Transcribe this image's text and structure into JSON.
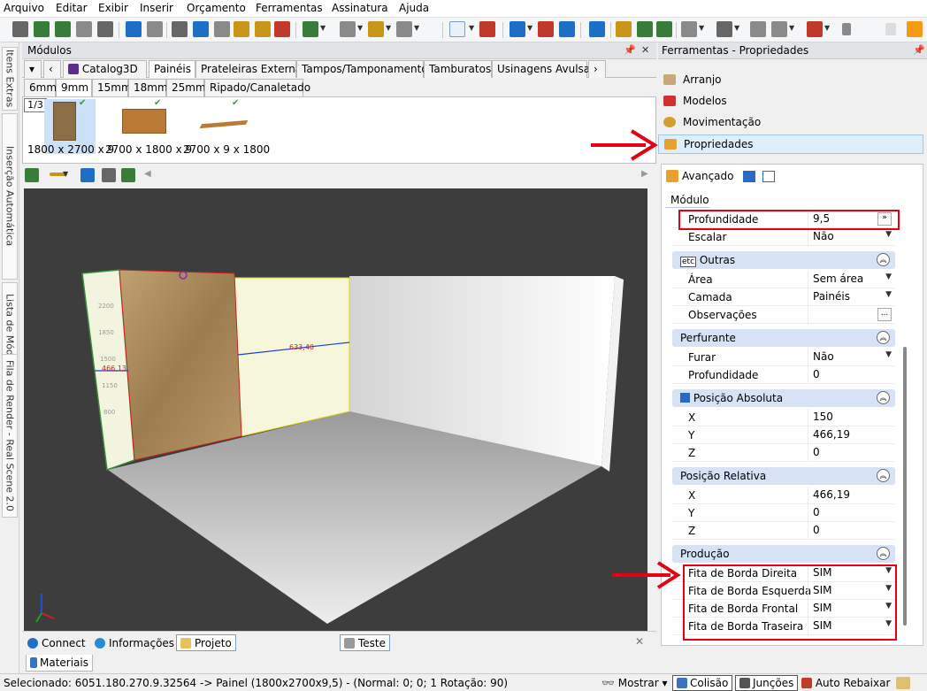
{
  "menu": [
    "Arquivo",
    "Editar",
    "Exibir",
    "Inserir",
    "Orçamento",
    "Ferramentas",
    "Assinatura",
    "Ajuda"
  ],
  "left_tabs": [
    "Itens Extras",
    "Inserção Automática",
    "Lista de Módulos",
    "Fila de Render - Real Scene 2.0"
  ],
  "modulos": {
    "title": "Módulos",
    "tabs": [
      "Catalog3D",
      "Painéis",
      "Prateleiras Externas",
      "Tampos/Tamponamentos",
      "Tamburatos",
      "Usinagens Avulsas"
    ],
    "thickness_tabs": [
      "6mm",
      "9mm",
      "15mm",
      "18mm",
      "25mm",
      "Ripado/Canaletado"
    ],
    "page": "1/3",
    "thumbs": [
      "1800 x 2700 x 9",
      "2700 x 1800 x 9",
      "2700 x 9 x 1800"
    ],
    "dims": [
      "466,13",
      "633,40",
      "2200",
      "1850",
      "1500",
      "1150",
      "800"
    ]
  },
  "bottom_tabs": [
    "Connect",
    "Informações",
    "Projeto",
    "Teste"
  ],
  "materiais": "Materiais",
  "ferramentas": {
    "title": "Ferramentas - Propriedades",
    "items": [
      "Arranjo",
      "Modelos",
      "Movimentação",
      "Propriedades"
    ]
  },
  "props": {
    "avancado": "Avançado",
    "modulo": "Módulo",
    "profundidade": {
      "label": "Profundidade",
      "value": "9,5",
      "btn": "»"
    },
    "escalar": {
      "label": "Escalar",
      "value": "Não"
    },
    "outras": "Outras",
    "outras_icon": "etc",
    "area": {
      "label": "Área",
      "value": "Sem área"
    },
    "camada": {
      "label": "Camada",
      "value": "Painéis"
    },
    "obs": {
      "label": "Observações",
      "value": "",
      "btn": "..."
    },
    "perfurante": "Perfurante",
    "furar": {
      "label": "Furar",
      "value": "Não"
    },
    "prof2": {
      "label": "Profundidade",
      "value": "0"
    },
    "pos_abs": "Posição Absoluta",
    "abs_x": {
      "label": "X",
      "value": "150"
    },
    "abs_y": {
      "label": "Y",
      "value": "466,19"
    },
    "abs_z": {
      "label": "Z",
      "value": "0"
    },
    "pos_rel": "Posição Relativa",
    "rel_x": {
      "label": "X",
      "value": "466,19"
    },
    "rel_y": {
      "label": "Y",
      "value": "0"
    },
    "rel_z": {
      "label": "Z",
      "value": "0"
    },
    "producao": "Produção",
    "fita_dir": {
      "label": "Fita de Borda Direita",
      "value": "SIM"
    },
    "fita_esq": {
      "label": "Fita de Borda Esquerda",
      "value": "SIM"
    },
    "fita_fro": {
      "label": "Fita de Borda Frontal",
      "value": "SIM"
    },
    "fita_tra": {
      "label": "Fita de Borda Traseira",
      "value": "SIM"
    }
  },
  "status": {
    "selected": "Selecionado: 6051.180.270.9.32564 -> Painel (1800x2700x9,5) - (Normal: 0; 0; 1 Rotação: 90)",
    "mostrar": "Mostrar",
    "colisao": "Colisão",
    "juncoes": "Junções",
    "auto": "Auto Rebaixar"
  },
  "colors": {
    "accent": "#1e6fc8",
    "annotation": "#e60012",
    "section": "#d7e3f4"
  }
}
